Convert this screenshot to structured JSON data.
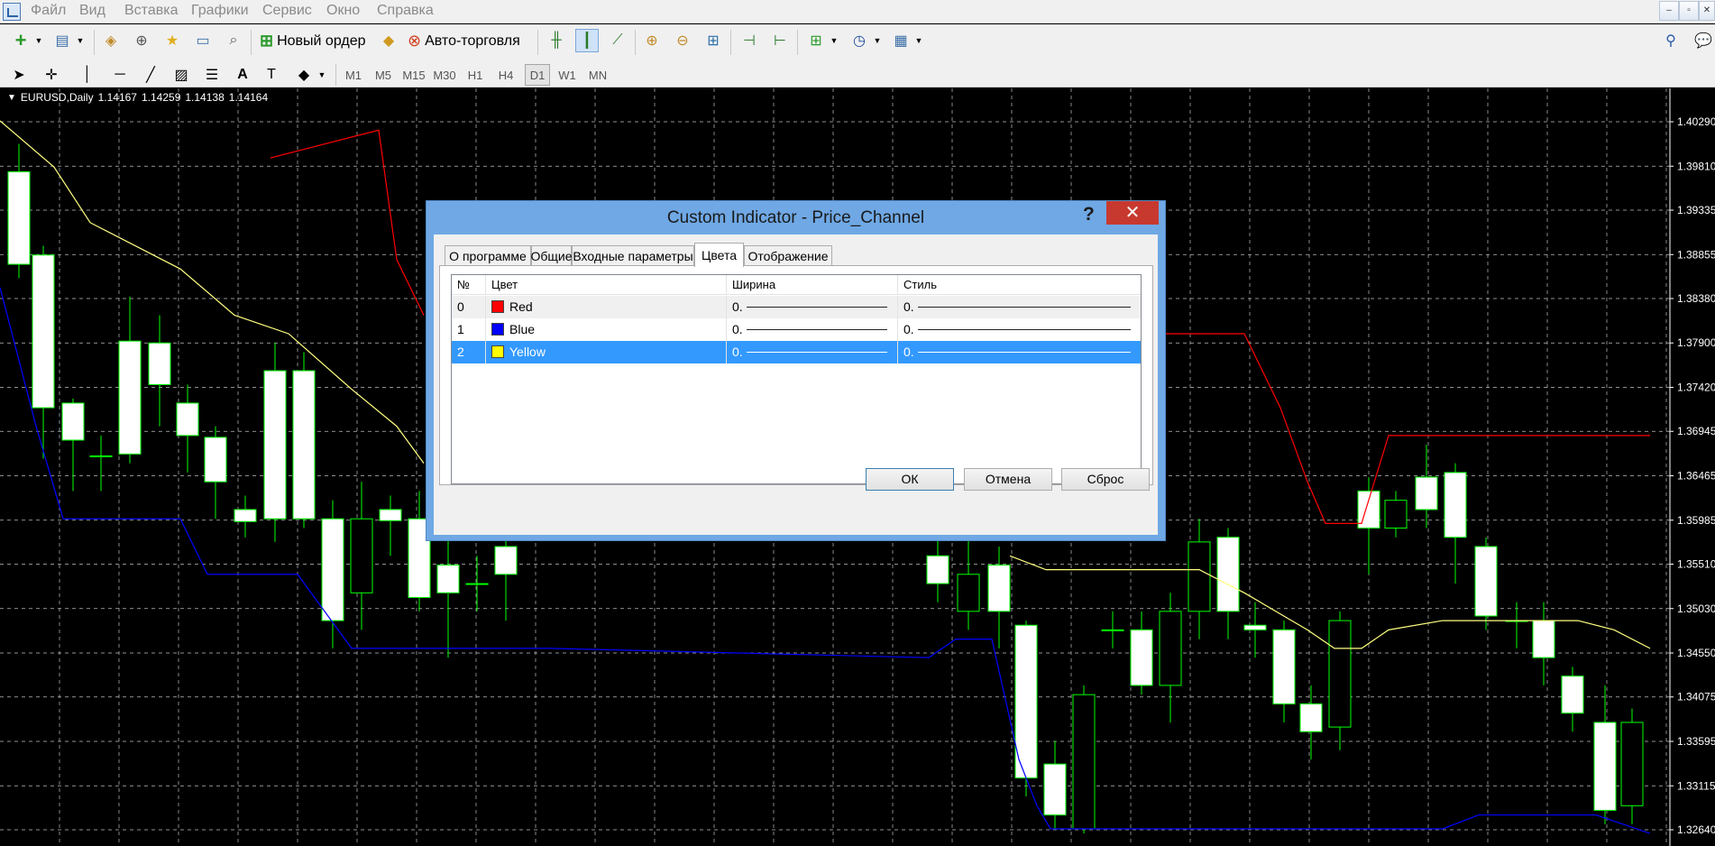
{
  "menu": [
    "Файл",
    "Вид",
    "Вставка",
    "Графики",
    "Сервис",
    "Окно",
    "Справка"
  ],
  "toolbar": {
    "new_order": "Новый ордер",
    "autotrading": "Авто-торговля"
  },
  "timeframes": [
    "M1",
    "M5",
    "M15",
    "M30",
    "H1",
    "H4",
    "D1",
    "W1",
    "MN"
  ],
  "active_timeframe": "D1",
  "chart": {
    "symbol": "EURUSD,Daily",
    "ohlc": [
      "1.14167",
      "1.14259",
      "1.14138",
      "1.14164"
    ],
    "price_labels": [
      "1.40290",
      "1.39810",
      "1.39335",
      "1.38855",
      "1.38380",
      "1.37900",
      "1.37420",
      "1.36945",
      "1.36465",
      "1.35985",
      "1.35510",
      "1.35030",
      "1.34550",
      "1.34075",
      "1.33595",
      "1.33115",
      "1.32640"
    ]
  },
  "dialog": {
    "title": "Custom Indicator - Price_Channel",
    "help": "?",
    "close": "✕",
    "tabs": [
      "О программе",
      "Общие",
      "Входные параметры",
      "Цвета",
      "Отображение"
    ],
    "active_tab": "Цвета",
    "columns": [
      "№",
      "Цвет",
      "Ширина",
      "Стиль"
    ],
    "rows": [
      {
        "n": "0",
        "color": "Red",
        "hex": "#ff0000",
        "width": "0.",
        "style": "0."
      },
      {
        "n": "1",
        "color": "Blue",
        "hex": "#0000ff",
        "width": "0.",
        "style": "0."
      },
      {
        "n": "2",
        "color": "Yellow",
        "hex": "#ffff00",
        "width": "0.",
        "style": "0.",
        "selected": true
      }
    ],
    "buttons": {
      "ok": "ОК",
      "cancel": "Отмена",
      "reset": "Сброс"
    }
  },
  "colors": {
    "bull": "#00ff00",
    "channel_red": "#ff0000",
    "channel_blue": "#0000ff",
    "channel_yellow": "#ffff80",
    "grid": "#c0c0c0"
  }
}
